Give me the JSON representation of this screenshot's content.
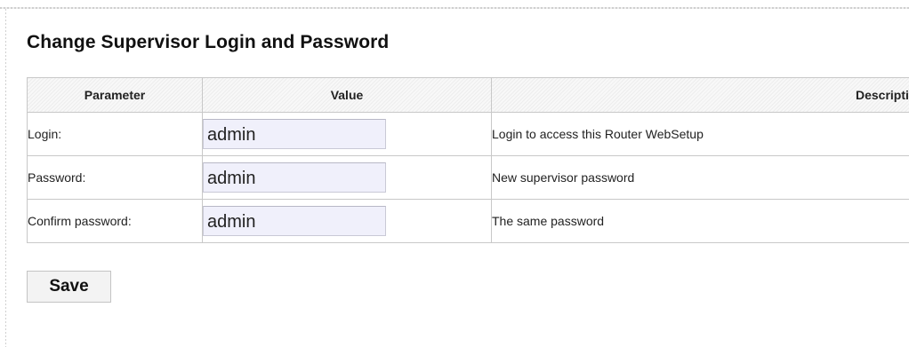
{
  "header": {
    "title": "Change Supervisor Login and Password"
  },
  "table": {
    "columns": {
      "parameter": "Parameter",
      "value": "Value",
      "description": "Description"
    },
    "rows": [
      {
        "label": "Login:",
        "value": "admin",
        "description": "Login to access this Router WebSetup"
      },
      {
        "label": "Password:",
        "value": "admin",
        "description": "New supervisor password"
      },
      {
        "label": "Confirm password:",
        "value": "admin",
        "description": "The same password"
      }
    ]
  },
  "actions": {
    "save_label": "Save"
  },
  "colors": {
    "input_background": "#f0f0fb",
    "border": "#c8c8c8"
  }
}
